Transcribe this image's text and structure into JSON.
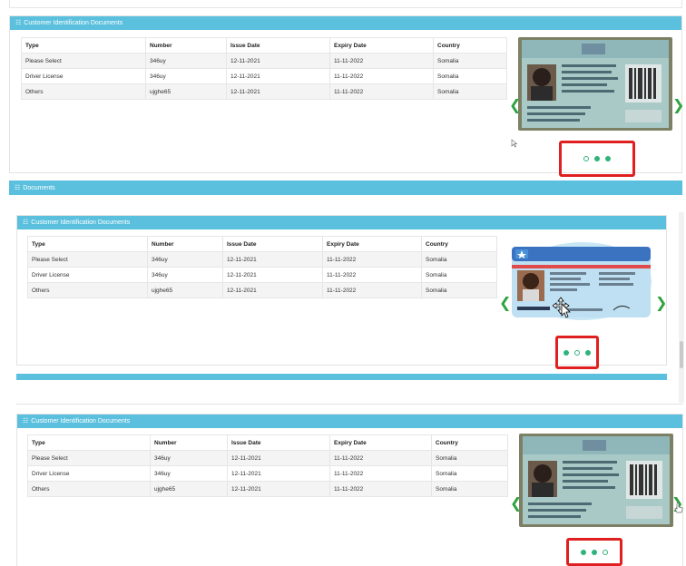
{
  "sections": [
    {
      "header": "Customer Identification Documents",
      "columns": [
        "Type",
        "Number",
        "Issue Date",
        "Expiry Date",
        "Country"
      ],
      "rows": [
        [
          "Please Select",
          "346uy",
          "12-11-2021",
          "11-11-2022",
          "Somalia"
        ],
        [
          "Driver License",
          "346uy",
          "12-11-2021",
          "11-11-2022",
          "Somalia"
        ],
        [
          "Others",
          "ujghe65",
          "12-11-2021",
          "11-11-2022",
          "Somalia"
        ]
      ],
      "carousel": {
        "image": "motor-vehicle-ownership-card",
        "active_slide": 3,
        "total": 3
      }
    },
    {
      "header": "Customer Identification Documents",
      "columns": [
        "Type",
        "Number",
        "Issue Date",
        "Expiry Date",
        "Country"
      ],
      "rows": [
        [
          "Please Select",
          "346uy",
          "12-11-2021",
          "11-11-2022",
          "Somalia"
        ],
        [
          "Driver License",
          "346uy",
          "12-11-2021",
          "11-11-2022",
          "Somalia"
        ],
        [
          "Others",
          "ujghe65",
          "12-11-2021",
          "11-11-2022",
          "Somalia"
        ]
      ],
      "carousel": {
        "image": "somalia-driving-license",
        "active_slide": 2,
        "total": 3
      }
    },
    {
      "header": "Customer Identification Documents",
      "columns": [
        "Type",
        "Number",
        "Issue Date",
        "Expiry Date",
        "Country"
      ],
      "rows": [
        [
          "Please Select",
          "346uy",
          "12-11-2021",
          "11-11-2022",
          "Somalia"
        ],
        [
          "Driver License",
          "346uy",
          "12-11-2021",
          "11-11-2022",
          "Somalia"
        ],
        [
          "Others",
          "ujghe65",
          "12-11-2021",
          "11-11-2022",
          "Somalia"
        ]
      ],
      "carousel": {
        "image": "motor-vehicle-ownership-card",
        "active_slide": 3,
        "total": 3
      }
    }
  ],
  "documents_header": "Documents",
  "colors": {
    "header": "#5bc0de",
    "accent": "#2fb37a",
    "arrow": "#2fa33f",
    "highlight": "#e02020"
  },
  "icons": {
    "prev": "chevron-left-icon",
    "next": "chevron-right-icon",
    "section": "list-icon"
  }
}
